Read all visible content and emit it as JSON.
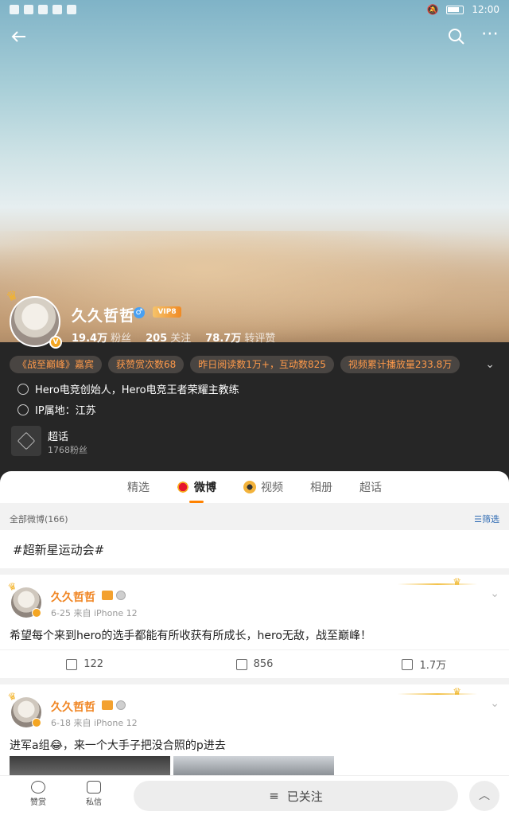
{
  "status_bar": {
    "time": "12:00"
  },
  "profile": {
    "name": "久久哲哲",
    "vip_label": "VIP8",
    "stats": [
      {
        "value": "19.4万",
        "label": "粉丝"
      },
      {
        "value": "205",
        "label": "关注"
      },
      {
        "value": "78.7万",
        "label": "转评赞"
      }
    ],
    "tags": [
      "《战至巅峰》嘉宾",
      "获赞赏次数68",
      "昨日阅读数1万+，互动数825",
      "视频累计播放量233.8万"
    ],
    "bio": "Hero电竞创始人，Hero电竞王者荣耀主教练",
    "ip_location": "IP属地：江苏",
    "super_topic": {
      "title": "超话",
      "subtitle": "1768粉丝"
    }
  },
  "tabs": [
    {
      "label": "精选",
      "active": false
    },
    {
      "label": "微博",
      "active": true
    },
    {
      "label": "视频",
      "active": false
    },
    {
      "label": "相册",
      "active": false
    },
    {
      "label": "超话",
      "active": false
    }
  ],
  "filter": {
    "all_label": "全部微博(166)",
    "filter_label": "筛选"
  },
  "hashtag": "#超新星运动会#",
  "posts": [
    {
      "author": "久久哲哲",
      "date": "6-25",
      "source": "来自 iPhone 12",
      "text": "希望每个来到hero的选手都能有所收获有所成长，hero无敌，战至巅峰！",
      "reposts": "122",
      "comments": "856",
      "likes": "1.7万"
    },
    {
      "author": "久久哲哲",
      "date": "6-18",
      "source": "来自 iPhone 12",
      "text": "进军a组😂，来一个大手子把没合照的p进去"
    }
  ],
  "bottom_bar": {
    "reward_label": "赞赏",
    "message_label": "私信",
    "follow_label": "已关注"
  },
  "colors": {
    "accent": "#ff8200",
    "name_orange": "#f08624",
    "link_blue": "#2f6bb3"
  }
}
